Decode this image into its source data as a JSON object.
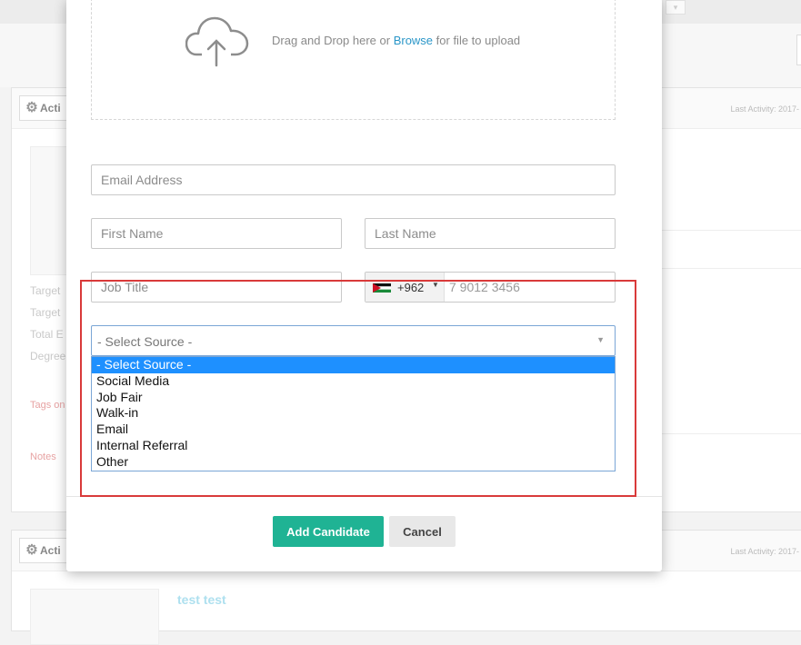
{
  "background": {
    "actions_label": "Acti",
    "last_activity": "Last Activity: 2017-",
    "side_labels": [
      "Target",
      "Target",
      "Total E",
      "Degree"
    ],
    "tags_label": "Tags on",
    "notes_label": "Notes",
    "candidate_name": "test test"
  },
  "upload": {
    "prefix": "Drag and Drop here or ",
    "browse": "Browse",
    "suffix": " for file to upload"
  },
  "form": {
    "email_placeholder": "Email Address",
    "first_name_placeholder": "First Name",
    "last_name_placeholder": "Last Name",
    "job_title_placeholder": "Job Title",
    "phone": {
      "dial_code": "+962",
      "placeholder": "7 9012 3456"
    },
    "source": {
      "selected": "- Select Source -",
      "options": [
        "- Select Source -",
        "Social Media",
        "Job Fair",
        "Walk-in",
        "Email",
        "Internal Referral",
        "Other"
      ]
    }
  },
  "buttons": {
    "add": "Add Candidate",
    "cancel": "Cancel"
  },
  "colors": {
    "primary": "#1fb394",
    "link": "#2a96c8",
    "select_highlight": "#1e90ff",
    "annotation_red": "#d93a3a"
  }
}
